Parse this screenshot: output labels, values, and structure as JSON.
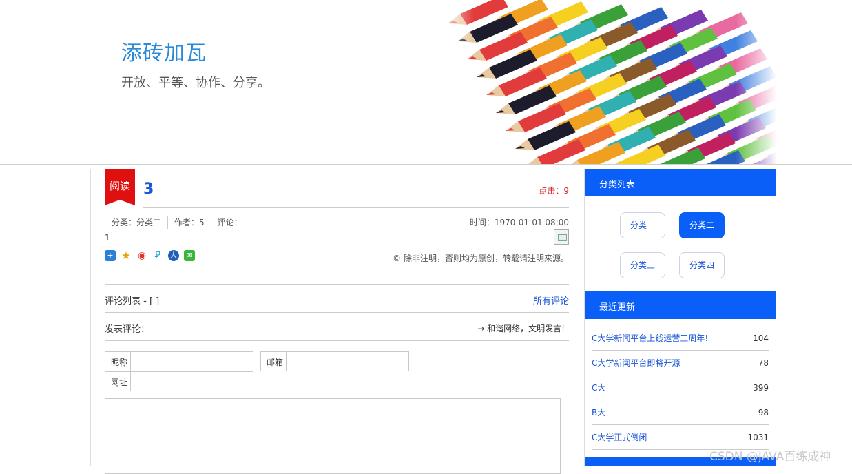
{
  "header": {
    "site_title": "添砖加瓦",
    "slogan": "开放、平等、协作、分享。",
    "banner_image": "colored-pencils-image"
  },
  "article": {
    "ribbon_label": "阅读",
    "title": "3",
    "hits": "点击：9",
    "meta": {
      "category": "分类：分类二",
      "author": "作者：5",
      "comments": "评论："
    },
    "time": "时间：1970-01-01 08:00",
    "body": "1",
    "share_icons": [
      "share-plus-icon",
      "qzone-icon",
      "weibo-icon",
      "pengyou-icon",
      "renren-icon",
      "wechat-icon"
    ],
    "copyright": "© 除非注明，否则均为原创，转载请注明来源。"
  },
  "comments": {
    "list_label": "评论列表 - [ ]",
    "all_link": "所有评论",
    "post_label": "发表评论：",
    "civil_note": "→ 和谐网络，文明发言!",
    "nickname_label": "昵称",
    "email_label": "邮箱",
    "url_label": "网址"
  },
  "sidebar": {
    "categories_title": "分类列表",
    "categories": [
      "分类一",
      "分类二",
      "分类三",
      "分类四"
    ],
    "active_category": "分类二",
    "recent_title": "最近更新",
    "recent": [
      {
        "name": "C大学新闻平台上线运营三周年!",
        "count": "104"
      },
      {
        "name": "C大学新闻平台即将开源",
        "count": "78"
      },
      {
        "name": "C大",
        "count": "399"
      },
      {
        "name": "B大",
        "count": "98"
      },
      {
        "name": "C大学正式倒闭",
        "count": "1031"
      }
    ]
  },
  "colors": {
    "accent": "#0a5ff8",
    "title_blue": "#2a8ad8",
    "ribbon_red": "#e01010"
  },
  "watermark": "CSDN @JAVA百练成神"
}
